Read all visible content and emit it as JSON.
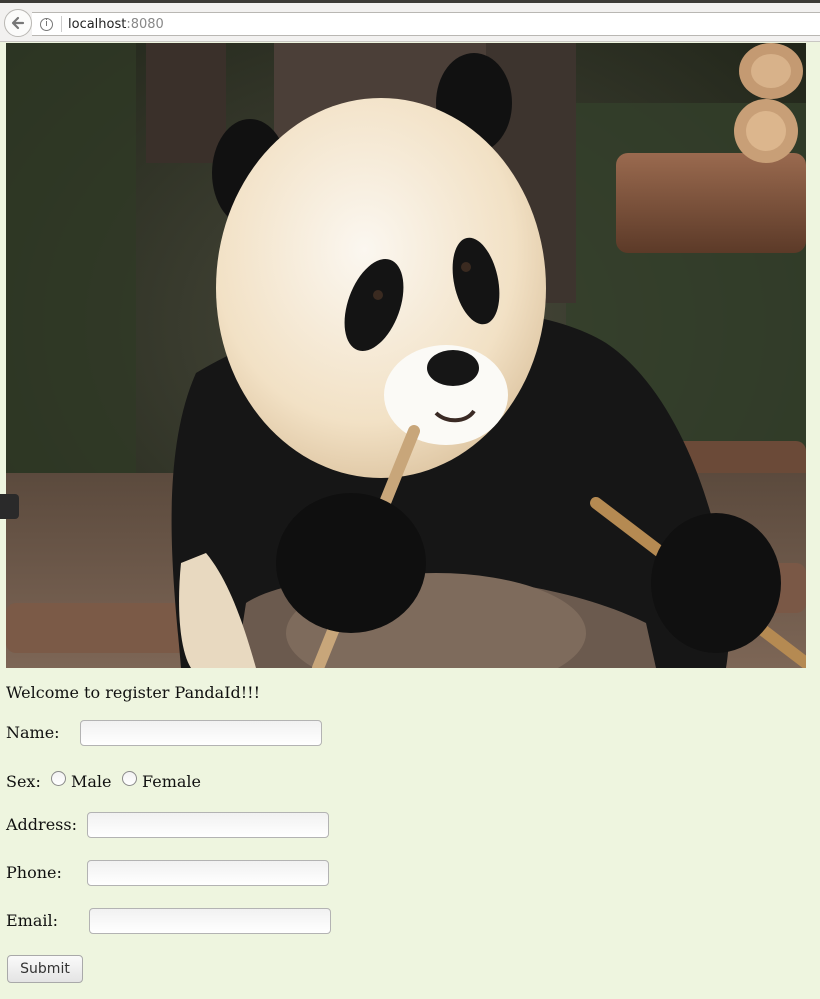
{
  "browser": {
    "url_host": "localhost",
    "url_port": ":8080",
    "info_symbol": "i"
  },
  "photo": {
    "subject": "panda-icon"
  },
  "form": {
    "welcome": "Welcome to register PandaId!!!",
    "name_label": "Name:",
    "sex_label": "Sex:",
    "sex_options": [
      "Male",
      "Female"
    ],
    "address_label": "Address:",
    "phone_label": "Phone:",
    "email_label": "Email:",
    "submit_label": "Submit"
  },
  "colors": {
    "page_background": "#eef5df"
  }
}
